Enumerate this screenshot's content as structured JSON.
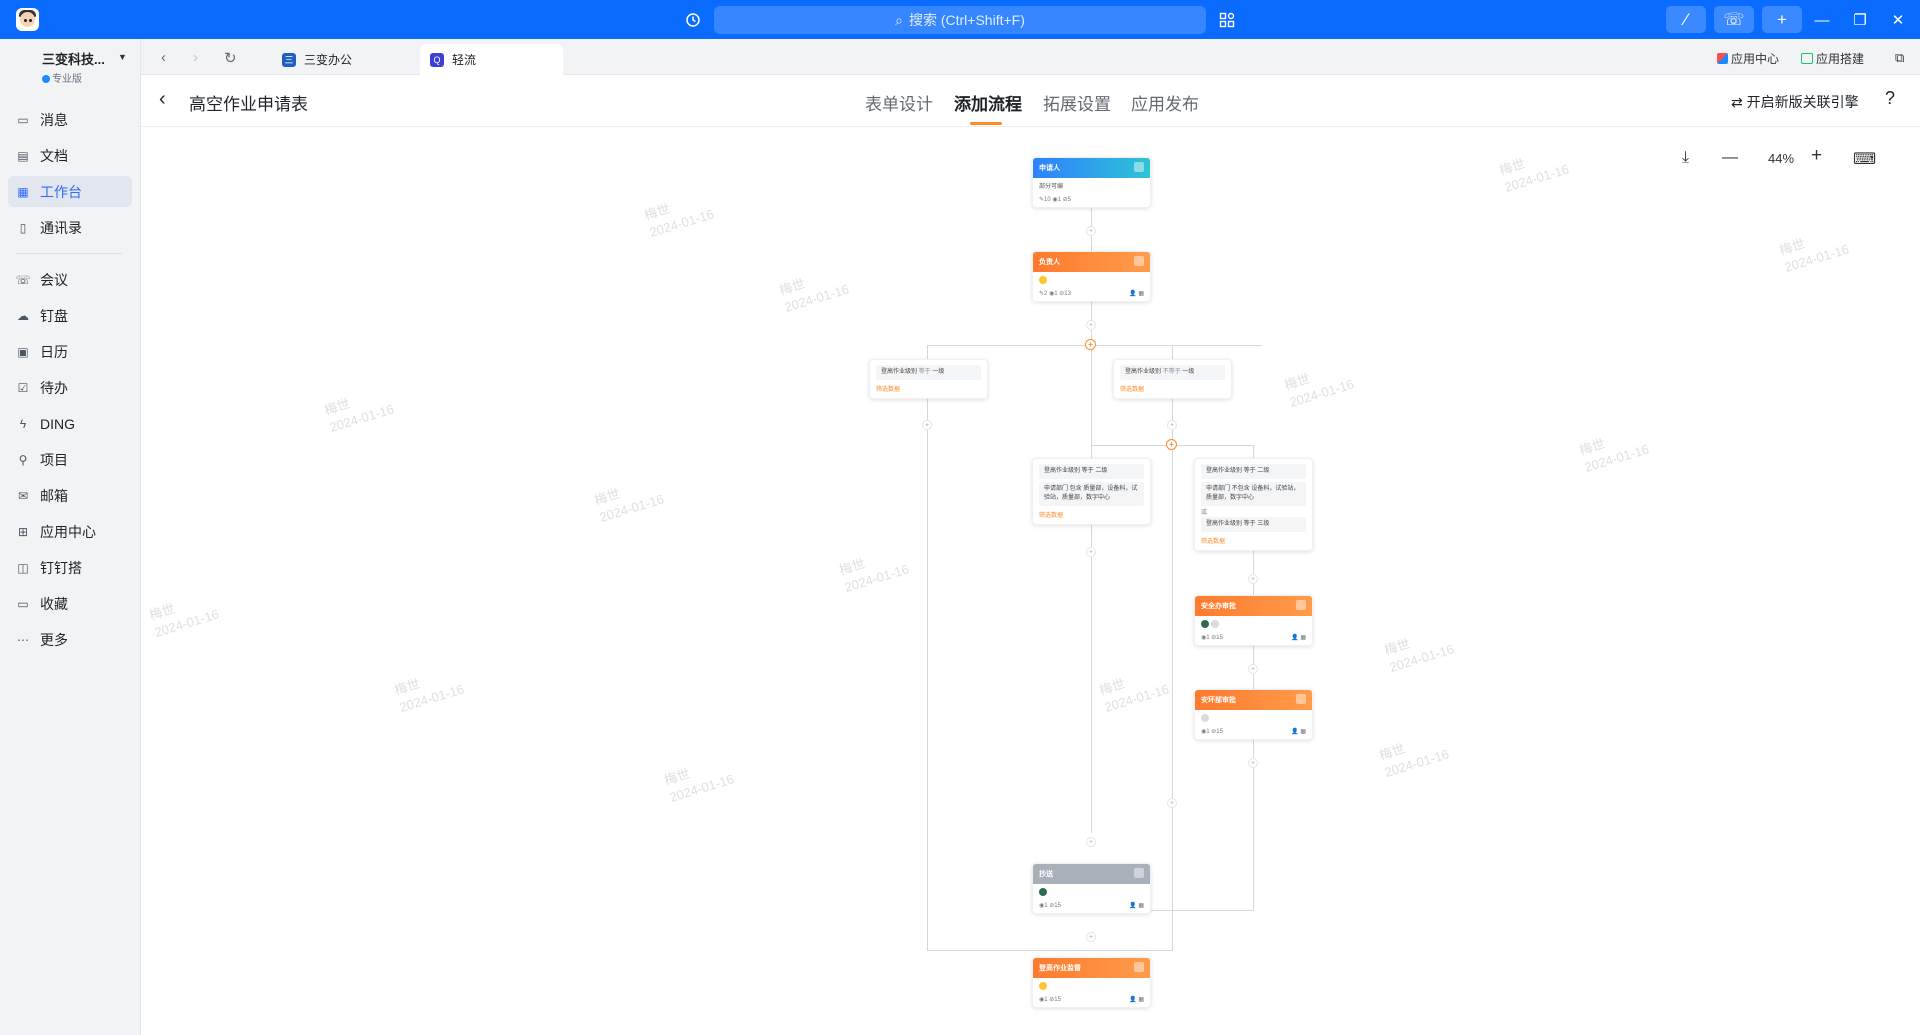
{
  "titlebar": {
    "search_placeholder": "搜索 (Ctrl+Shift+F)"
  },
  "sidebar": {
    "org_name": "三变科技...",
    "org_badge": "专业版",
    "items": [
      {
        "label": "消息",
        "icon": "chat-bubble-icon"
      },
      {
        "label": "文档",
        "icon": "document-icon"
      },
      {
        "label": "工作台",
        "icon": "grid-apps-icon",
        "active": true
      },
      {
        "label": "通讯录",
        "icon": "contacts-book-icon"
      },
      {
        "label": "会议",
        "icon": "phone-meeting-icon"
      },
      {
        "label": "钉盘",
        "icon": "cloud-drive-icon"
      },
      {
        "label": "日历",
        "icon": "calendar-icon"
      },
      {
        "label": "待办",
        "icon": "checkbox-todo-icon"
      },
      {
        "label": "DING",
        "icon": "lightning-icon"
      },
      {
        "label": "项目",
        "icon": "project-icon"
      },
      {
        "label": "邮箱",
        "icon": "mail-icon"
      },
      {
        "label": "应用中心",
        "icon": "app-center-icon"
      },
      {
        "label": "钉钉搭",
        "icon": "builder-icon"
      },
      {
        "label": "收藏",
        "icon": "favorites-icon"
      },
      {
        "label": "更多",
        "icon": "more-dots-icon"
      }
    ]
  },
  "tabs": [
    {
      "label": "三变办公",
      "color": "#1f5fbf"
    },
    {
      "label": "轻流",
      "color": "#3b3fd8",
      "active": true
    }
  ],
  "strip_right": {
    "app_center": "应用中心",
    "app_build": "应用搭建"
  },
  "page": {
    "title": "高空作业申请表",
    "tabs": [
      "表单设计",
      "添加流程",
      "拓展设置",
      "应用发布"
    ],
    "active_tab": "添加流程",
    "engine_link": "开启新版关联引擎",
    "help": "?"
  },
  "canvas": {
    "zoom": "44%",
    "watermark_name": "梅世",
    "watermark_date": "2024-01-16"
  },
  "flow": {
    "applicant": {
      "title": "申请人",
      "sub": "部分可编",
      "stats": "✎10 ◉1 ⊘5"
    },
    "leader": {
      "title": "负责人",
      "stats": "✎2 ◉1 ⊘13"
    },
    "cond_left": {
      "field": "登高作业级别",
      "op": "等于",
      "val": "一级",
      "link": "筛选数据"
    },
    "cond_right": {
      "field": "登高作业级别",
      "op": "不等于",
      "val": "一级",
      "link": "筛选数据"
    },
    "cond_mid_a": {
      "row1": "登高作业级别 等于 二级",
      "row2": "申请部门 包含 质量部，设备科，试验站，质量部，数字中心",
      "link": "筛选数据"
    },
    "cond_mid_b": {
      "row1": "登高作业级别 等于 二级",
      "row2": "申请部门 不包含 设备科，试验站，质量部，数字中心",
      "row3": "或",
      "row4": "登高作业级别 等于 三级",
      "link": "筛选数据"
    },
    "safety": {
      "title": "安全办审批",
      "stats": "◉1 ⊘15"
    },
    "env": {
      "title": "安环部审批",
      "stats": "◉1 ⊘15"
    },
    "cc": {
      "title": "抄送",
      "stats": "◉1 ⊘15"
    },
    "final": {
      "title": "登高作业监督",
      "stats": "◉1 ⊘15"
    }
  }
}
